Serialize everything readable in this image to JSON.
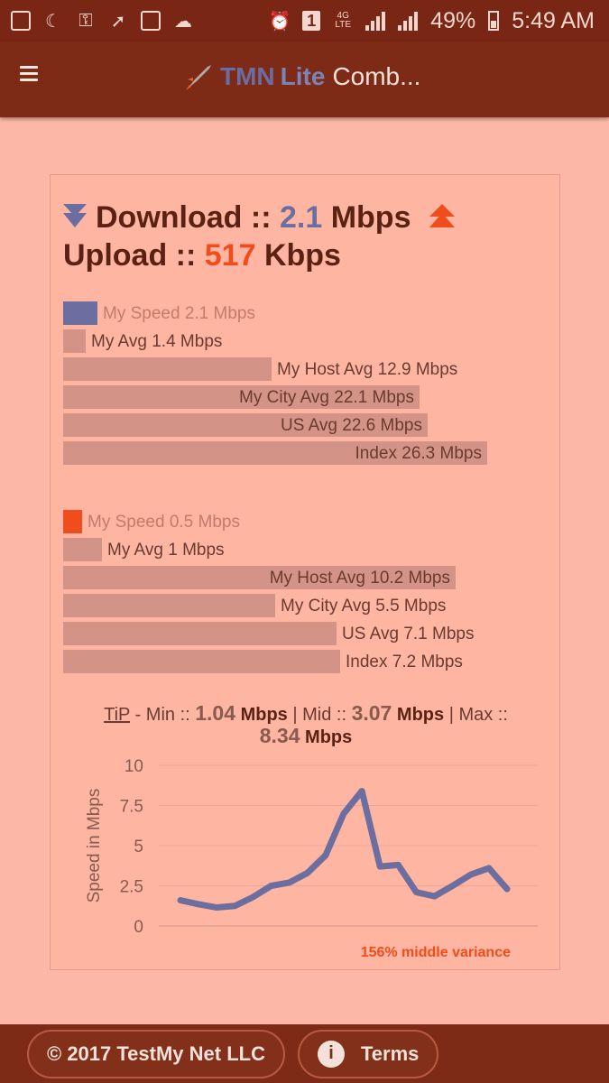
{
  "status_bar": {
    "battery": "49%",
    "time": "5:49 AM",
    "notification_badge": "1",
    "network": "4G LTE"
  },
  "app_bar": {
    "title_brand": "TMN",
    "title_lite": "Lite",
    "title_rest": "Comb..."
  },
  "summary": {
    "download_label": "Download ::",
    "download_value": "2.1",
    "download_unit": "Mbps",
    "upload_label": "Upload ::",
    "upload_value": "517",
    "upload_unit": "Kbps"
  },
  "download_bars": [
    {
      "label": "My Speed 2.1 Mbps",
      "value": 2.1
    },
    {
      "label": "My Avg 1.4 Mbps",
      "value": 1.4
    },
    {
      "label": "My Host Avg 12.9 Mbps",
      "value": 12.9
    },
    {
      "label": "My City Avg 22.1 Mbps",
      "value": 22.1
    },
    {
      "label": "US Avg 22.6 Mbps",
      "value": 22.6
    },
    {
      "label": "Index 26.3 Mbps",
      "value": 26.3
    }
  ],
  "upload_bars": [
    {
      "label": "My Speed 0.5 Mbps",
      "value": 0.5
    },
    {
      "label": "My Avg 1 Mbps",
      "value": 1
    },
    {
      "label": "My Host Avg 10.2 Mbps",
      "value": 10.2
    },
    {
      "label": "My City Avg 5.5 Mbps",
      "value": 5.5
    },
    {
      "label": "US Avg 7.1 Mbps",
      "value": 7.1
    },
    {
      "label": "Index 7.2 Mbps",
      "value": 7.2
    }
  ],
  "tip": {
    "link": "TiP",
    "min_label": "- Min ::",
    "min_value": "1.04",
    "mid_label": "| Mid ::",
    "mid_value": "3.07",
    "max_label": "| Max ::",
    "max_value": "8.34",
    "unit": "Mbps"
  },
  "chart_data": {
    "type": "line",
    "ylabel": "Speed in Mbps",
    "ylim": [
      0,
      10
    ],
    "yticks": [
      "10",
      "7.5",
      "5",
      "2.5",
      "0"
    ],
    "series": [
      {
        "values": [
          1.6,
          1.35,
          1.15,
          1.25,
          1.8,
          2.5,
          2.7,
          3.3,
          4.4,
          7.0,
          8.4,
          3.7,
          3.8,
          2.1,
          1.85,
          2.5,
          3.2,
          3.6,
          2.3
        ]
      }
    ],
    "annotation": "156% middle variance",
    "color": "#6b6e9f"
  },
  "footer": {
    "copyright": "© 2017 TestMy Net LLC",
    "terms": "Terms"
  },
  "colors": {
    "download": "#6b6e9f",
    "upload": "#f04d1c",
    "background": "#fdb7a6",
    "bar": "#d39386"
  }
}
